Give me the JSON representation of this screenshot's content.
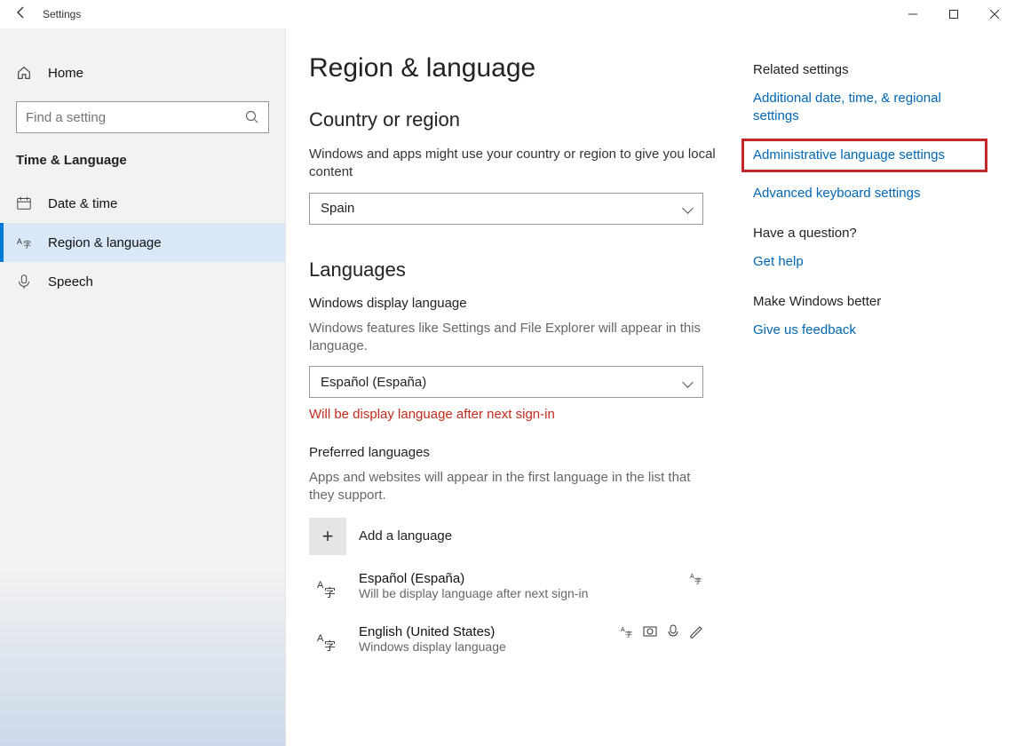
{
  "window": {
    "title": "Settings"
  },
  "sidebar": {
    "home": "Home",
    "search_placeholder": "Find a setting",
    "category": "Time & Language",
    "items": [
      {
        "label": "Date & time"
      },
      {
        "label": "Region & language"
      },
      {
        "label": "Speech"
      }
    ]
  },
  "main": {
    "title": "Region & language",
    "region": {
      "heading": "Country or region",
      "desc": "Windows and apps might use your country or region to give you local content",
      "value": "Spain"
    },
    "languages": {
      "heading": "Languages",
      "display_sub": "Windows display language",
      "display_desc": "Windows features like Settings and File Explorer will appear in this language.",
      "display_value": "Español (España)",
      "display_warn": "Will be display language after next sign-in",
      "preferred_sub": "Preferred languages",
      "preferred_desc": "Apps and websites will appear in the first language in the list that they support.",
      "add_label": "Add a language",
      "items": [
        {
          "name": "Español (España)",
          "sub": "Will be display language after next sign-in"
        },
        {
          "name": "English (United States)",
          "sub": "Windows display language"
        }
      ]
    }
  },
  "right": {
    "related_head": "Related settings",
    "link1": "Additional date, time, & regional settings",
    "link2": "Administrative language settings",
    "link3": "Advanced keyboard settings",
    "question_head": "Have a question?",
    "help_link": "Get help",
    "feedback_head": "Make Windows better",
    "feedback_link": "Give us feedback"
  }
}
